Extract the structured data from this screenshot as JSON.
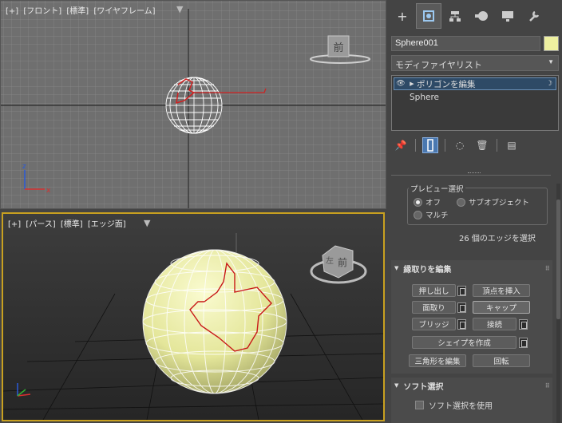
{
  "front_viewport": {
    "label_plus": "[+]",
    "label_view": "[フロント]",
    "label_shading": "[標準]",
    "label_mode": "[ワイヤフレーム]",
    "viewcube_face": "前",
    "axis_x": "x",
    "axis_z": "z"
  },
  "persp_viewport": {
    "label_plus": "[+]",
    "label_view": "[パース]",
    "label_shading": "[標準]",
    "label_mode": "[エッジ面]",
    "viewcube_face": "前",
    "viewcube_side": "左"
  },
  "command_panel": {
    "tabs": [
      "create",
      "modify",
      "hierarchy",
      "motion",
      "display",
      "utilities"
    ],
    "object_name": "Sphere001",
    "object_color": "#eef0a0",
    "modifier_list": "モディファイヤリスト",
    "stack": {
      "modifier": "ポリゴンを編集",
      "base": "Sphere"
    }
  },
  "preview_selection": {
    "title": "プレビュー選択",
    "off": "オフ",
    "subobject": "サブオブジェクト",
    "multi": "マルチ",
    "status": "26 個のエッジを選択"
  },
  "edit_edges": {
    "title": "縁取りを編集",
    "extrude": "押し出し",
    "insert_vertex": "頂点を挿入",
    "chamfer": "面取り",
    "cap": "キャップ",
    "bridge": "ブリッジ",
    "connect": "接続",
    "create_shape": "シェイプを作成",
    "edit_tri": "三角形を編集",
    "turn": "回転"
  },
  "soft_selection": {
    "title": "ソフト選択",
    "use": "ソフト選択を使用"
  }
}
